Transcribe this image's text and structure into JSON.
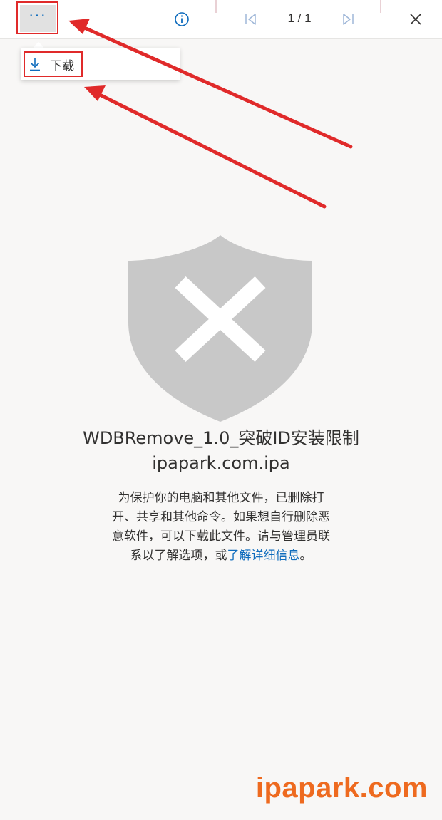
{
  "toolbar": {
    "more_label": "···",
    "page_indicator": "1 / 1",
    "icons": [
      "more-icon",
      "info-icon",
      "first-page-icon",
      "last-page-icon",
      "close-icon"
    ]
  },
  "menu": {
    "download_label": "下载",
    "icon": "download-icon"
  },
  "blocked": {
    "icon": "shield-x-icon",
    "filename": "WDBRemove_1.0_突破ID安装限制ipapark.com.ipa",
    "description": "为保护你的电脑和其他文件，已删除打开、共享和其他命令。如果想自行删除恶意软件，可以下载此文件。请与管理员联系以了解选项，或",
    "link_text": "了解详细信息",
    "description_end": "。"
  },
  "watermark": "ipapark.com",
  "colors": {
    "accent": "#0f6cbd",
    "highlight": "#e02a2a",
    "shield": "#c8c8c8",
    "watermark": "#ee6a1f",
    "background": "#f8f7f6"
  }
}
